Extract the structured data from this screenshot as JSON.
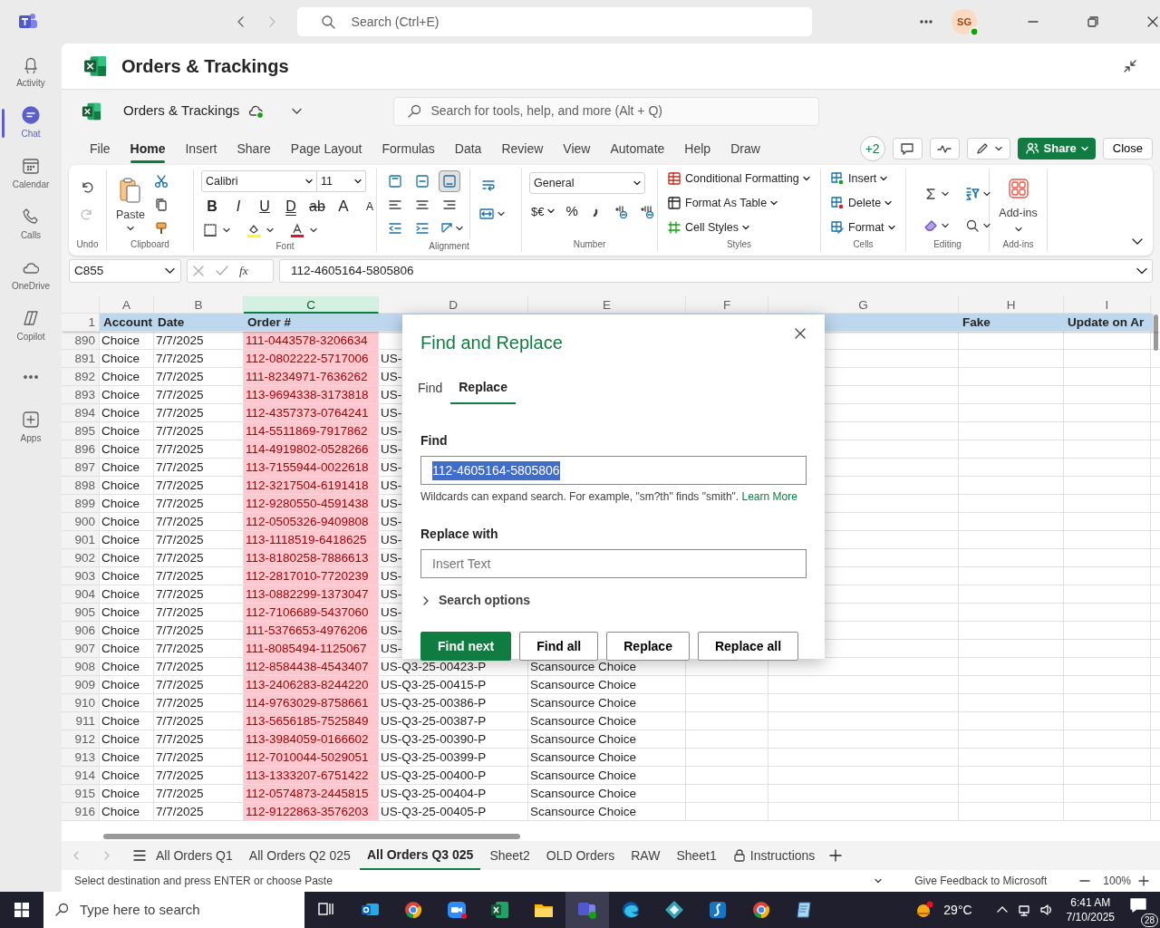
{
  "teams": {
    "search_placeholder": "Search (Ctrl+E)",
    "avatar": "SG",
    "rail": [
      {
        "label": "Activity",
        "kind": "bell",
        "selected": false
      },
      {
        "label": "Chat",
        "kind": "chat",
        "selected": true
      },
      {
        "label": "Calendar",
        "kind": "calendar",
        "selected": false
      },
      {
        "label": "Calls",
        "kind": "phone",
        "selected": false
      },
      {
        "label": "OneDrive",
        "kind": "cloud",
        "selected": false
      },
      {
        "label": "Copilot",
        "kind": "copilot",
        "selected": false
      },
      {
        "kind": "more",
        "selected": false
      },
      {
        "label": "Apps",
        "kind": "apps",
        "selected": false
      }
    ]
  },
  "app": {
    "title": "Orders & Trackings",
    "doc_name": "Orders & Trackings",
    "search_placeholder": "Search for tools, help, and more (Alt + Q)",
    "menu": [
      {
        "label": "File",
        "selected": false
      },
      {
        "label": "Home",
        "selected": true
      },
      {
        "label": "Insert",
        "selected": false
      },
      {
        "label": "Share",
        "selected": false
      },
      {
        "label": "Page Layout",
        "selected": false
      },
      {
        "label": "Formulas",
        "selected": false
      },
      {
        "label": "Data",
        "selected": false
      },
      {
        "label": "Review",
        "selected": false
      },
      {
        "label": "View",
        "selected": false
      },
      {
        "label": "Automate",
        "selected": false
      },
      {
        "label": "Help",
        "selected": false
      },
      {
        "label": "Draw",
        "selected": false
      }
    ],
    "collaborators": "+2",
    "share": "Share",
    "close": "Close"
  },
  "ribbon": {
    "groups": [
      "Undo",
      "Clipboard",
      "Font",
      "Alignment",
      "Number",
      "Styles",
      "Cells",
      "Editing",
      "Add-ins"
    ],
    "paste": "Paste",
    "font_name": "Calibri",
    "font_size": "11",
    "font_buttons": [
      {
        "label": "B",
        "kind": "bold"
      },
      {
        "label": "I",
        "kind": "italic"
      },
      {
        "label": "U",
        "kind": "underline"
      },
      {
        "label": "D",
        "kind": "double"
      },
      {
        "label": "ab",
        "kind": "strike"
      },
      {
        "label": "A",
        "kind": "grow"
      },
      {
        "label": "A",
        "kind": "shrink"
      }
    ],
    "number_format": "General",
    "currency": "$€",
    "percent": "%",
    "styles": [
      "Conditional Formatting",
      "Format As Table",
      "Cell Styles"
    ],
    "cells": [
      "Insert",
      "Delete",
      "Format"
    ],
    "addins": "Add-ins"
  },
  "formula_bar": {
    "name_box": "C855",
    "fx": "fx",
    "value": "112-4605164-5805806"
  },
  "sheet": {
    "columns": [
      {
        "label": "A",
        "selected": false
      },
      {
        "label": "B",
        "selected": false
      },
      {
        "label": "C",
        "selected": true
      },
      {
        "label": "D",
        "selected": false
      },
      {
        "label": "E",
        "selected": false
      },
      {
        "label": "F",
        "selected": false
      },
      {
        "label": "G",
        "selected": false
      },
      {
        "label": "H",
        "selected": false
      },
      {
        "label": "I",
        "selected": false
      }
    ],
    "header_row": {
      "number": "1",
      "column_a": "Account",
      "column_b": "Date",
      "column_c": "Order #",
      "column_h": "Fake",
      "column_i": "Update on Ar"
    },
    "rows": [
      {
        "number": "890",
        "account": "Choice",
        "date": "7/7/2025",
        "order": "111-0443578-3206634"
      },
      {
        "number": "891",
        "account": "Choice",
        "date": "7/7/2025",
        "order": "112-0802222-5717006",
        "column_d": "US-"
      },
      {
        "number": "892",
        "account": "Choice",
        "date": "7/7/2025",
        "order": "111-8234971-7636262",
        "column_d": "US-"
      },
      {
        "number": "893",
        "account": "Choice",
        "date": "7/7/2025",
        "order": "113-9694338-3173818",
        "column_d": "US-"
      },
      {
        "number": "894",
        "account": "Choice",
        "date": "7/7/2025",
        "order": "112-4357373-0764241",
        "column_d": "US-"
      },
      {
        "number": "895",
        "account": "Choice",
        "date": "7/7/2025",
        "order": "114-5511869-7917862",
        "column_d": "US-"
      },
      {
        "number": "896",
        "account": "Choice",
        "date": "7/7/2025",
        "order": "114-4919802-0528266",
        "column_d": "US-"
      },
      {
        "number": "897",
        "account": "Choice",
        "date": "7/7/2025",
        "order": "113-7155944-0022618",
        "column_d": "US-"
      },
      {
        "number": "898",
        "account": "Choice",
        "date": "7/7/2025",
        "order": "112-3217504-6191418",
        "column_d": "US-"
      },
      {
        "number": "899",
        "account": "Choice",
        "date": "7/7/2025",
        "order": "112-9280550-4591438",
        "column_d": "US-"
      },
      {
        "number": "900",
        "account": "Choice",
        "date": "7/7/2025",
        "order": "112-0505326-9409808",
        "column_d": "US-"
      },
      {
        "number": "901",
        "account": "Choice",
        "date": "7/7/2025",
        "order": "113-1118519-6418625",
        "column_d": "US-"
      },
      {
        "number": "902",
        "account": "Choice",
        "date": "7/7/2025",
        "order": "113-8180258-7886613",
        "column_d": "US-"
      },
      {
        "number": "903",
        "account": "Choice",
        "date": "7/7/2025",
        "order": "112-2817010-7720239",
        "column_d": "US-"
      },
      {
        "number": "904",
        "account": "Choice",
        "date": "7/7/2025",
        "order": "113-0882299-1373047",
        "column_d": "US-"
      },
      {
        "number": "905",
        "account": "Choice",
        "date": "7/7/2025",
        "order": "112-7106689-5437060",
        "column_d": "US-"
      },
      {
        "number": "906",
        "account": "Choice",
        "date": "7/7/2025",
        "order": "111-5376653-4976206",
        "column_d": "US-"
      },
      {
        "number": "907",
        "account": "Choice",
        "date": "7/7/2025",
        "order": "111-8085494-1125067",
        "column_d": "US-"
      },
      {
        "number": "908",
        "account": "Choice",
        "date": "7/7/2025",
        "order": "112-8584438-4543407",
        "column_d": "US-Q3-25-00423-P",
        "column_e": "Scansource Choice"
      },
      {
        "number": "909",
        "account": "Choice",
        "date": "7/7/2025",
        "order": "113-2406283-8244220",
        "column_d": "US-Q3-25-00415-P",
        "column_e": "Scansource Choice"
      },
      {
        "number": "910",
        "account": "Choice",
        "date": "7/7/2025",
        "order": "114-9763029-8758661",
        "column_d": "US-Q3-25-00386-P",
        "column_e": "Scansource Choice"
      },
      {
        "number": "911",
        "account": "Choice",
        "date": "7/7/2025",
        "order": "113-5656185-7525849",
        "column_d": "US-Q3-25-00387-P",
        "column_e": "Scansource Choice"
      },
      {
        "number": "912",
        "account": "Choice",
        "date": "7/7/2025",
        "order": "113-3984059-0166602",
        "column_d": "US-Q3-25-00390-P",
        "column_e": "Scansource Choice"
      },
      {
        "number": "913",
        "account": "Choice",
        "date": "7/7/2025",
        "order": "112-7010044-5029051",
        "column_d": "US-Q3-25-00399-P",
        "column_e": "Scansource Choice"
      },
      {
        "number": "914",
        "account": "Choice",
        "date": "7/7/2025",
        "order": "113-1333207-6751422",
        "column_d": "US-Q3-25-00400-P",
        "column_e": "Scansource Choice"
      },
      {
        "number": "915",
        "account": "Choice",
        "date": "7/7/2025",
        "order": "112-0574873-2445815",
        "column_d": "US-Q3-25-00404-P",
        "column_e": "Scansource Choice"
      },
      {
        "number": "916",
        "account": "Choice",
        "date": "7/7/2025",
        "order": "112-9122863-3576203",
        "column_d": "US-Q3-25-00405-P",
        "column_e": "Scansource Choice"
      }
    ]
  },
  "dialog": {
    "title": "Find and Replace",
    "tabs": [
      {
        "label": "Find",
        "selected": false
      },
      {
        "label": "Replace",
        "selected": true
      }
    ],
    "find_label": "Find",
    "find_value": "112-4605164-5805806",
    "find_value_selected": true,
    "hint": "Wildcards can expand search. For example, \"sm?th\" finds \"smith\".",
    "hint_link": "Learn More",
    "replace_label": "Replace with",
    "replace_placeholder": "Insert Text",
    "options_label": "Search options",
    "options_expanded": false,
    "buttons": [
      {
        "label": "Find next",
        "primary": true
      },
      {
        "label": "Find all",
        "primary": false
      },
      {
        "label": "Replace",
        "primary": false
      },
      {
        "label": "Replace all",
        "primary": false
      }
    ]
  },
  "sheet_tabs": [
    {
      "label": "All Orders Q1",
      "selected": false,
      "locked": false
    },
    {
      "label": "All Orders Q2 025",
      "selected": false,
      "locked": false
    },
    {
      "label": "All Orders Q3 025",
      "selected": true,
      "locked": false
    },
    {
      "label": "Sheet2",
      "selected": false,
      "locked": false
    },
    {
      "label": "OLD Orders",
      "selected": false,
      "locked": false
    },
    {
      "label": "RAW",
      "selected": false,
      "locked": false
    },
    {
      "label": "Sheet1",
      "selected": false,
      "locked": false
    },
    {
      "label": "Instructions",
      "selected": false,
      "locked": true
    }
  ],
  "status_bar": {
    "message": "Select destination and press ENTER or choose Paste",
    "feedback": "Give Feedback to Microsoft",
    "zoom": "100%"
  },
  "taskbar": {
    "search_placeholder": "Type here to search",
    "apps": [
      {
        "kind": "taskview",
        "selected": false
      },
      {
        "kind": "mail",
        "selected": false
      },
      {
        "kind": "chrome",
        "selected": false
      },
      {
        "kind": "zoom",
        "selected": false
      },
      {
        "kind": "excel",
        "selected": false
      },
      {
        "kind": "folder",
        "selected": false
      },
      {
        "kind": "teams",
        "selected": true
      },
      {
        "kind": "edge",
        "selected": false
      },
      {
        "kind": "diamond",
        "selected": false
      },
      {
        "kind": "script",
        "selected": false
      },
      {
        "kind": "chrome",
        "selected": false
      },
      {
        "kind": "notepad",
        "selected": false
      }
    ],
    "weather": "29°C",
    "time": "6:41 AM",
    "date": "7/10/2025",
    "notifications": "28"
  }
}
